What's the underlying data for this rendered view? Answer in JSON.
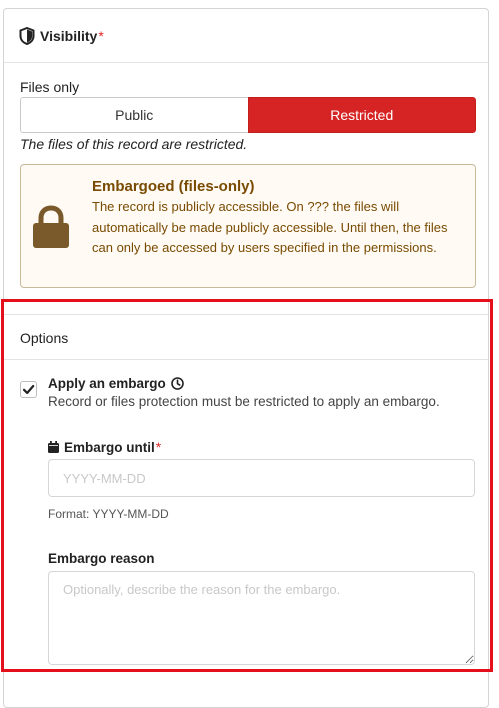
{
  "visibility": {
    "title": "Visibility",
    "required_mark": "*",
    "files_label": "Files only",
    "options": [
      "Public",
      "Restricted"
    ],
    "selected": "Restricted",
    "help_text": "The files of this record are restricted."
  },
  "embargo_notice": {
    "title": "Embargoed (files-only)",
    "description": "The record is publicly accessible. On ??? the files will automatically be made publicly accessible. Until then, the files can only be accessed by users specified in the permissions.",
    "colors": {
      "background": "#fffaf3",
      "text": "#794b02",
      "icon": "#7a5a2b"
    }
  },
  "options": {
    "title": "Options",
    "apply_embargo": {
      "label": "Apply an embargo",
      "checked": true,
      "description": "Record or files protection must be restricted to apply an embargo."
    },
    "embargo_until": {
      "label": "Embargo until",
      "required_mark": "*",
      "placeholder": "YYYY-MM-DD",
      "value": "",
      "format_hint": "Format: YYYY-MM-DD"
    },
    "embargo_reason": {
      "label": "Embargo reason",
      "placeholder": "Optionally, describe the reason for the embargo.",
      "value": ""
    }
  },
  "colors": {
    "accent": "#d62424",
    "highlight_frame": "#e3101c"
  },
  "icons": [
    "shield-icon",
    "lock-icon",
    "check-icon",
    "clock-icon",
    "calendar-icon"
  ]
}
